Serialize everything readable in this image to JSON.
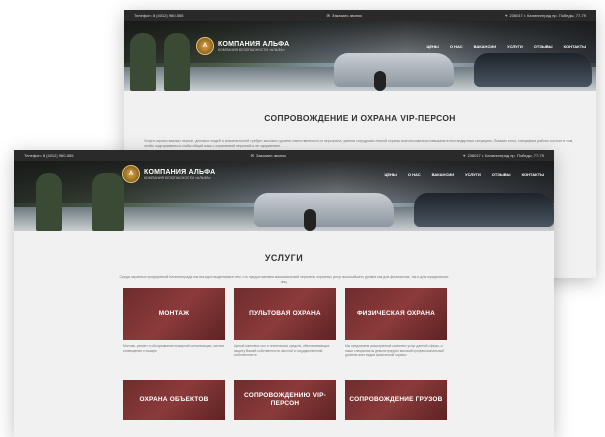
{
  "back_window": {
    "topbar": {
      "phone": "Телефон: 8 (4012) 960-555",
      "callback": "Заказать звонок",
      "address": "236017 г. Калининград пр. Победы, 77-79"
    },
    "brand": {
      "emblem": "A",
      "title": "КОМПАНИЯ АЛЬФА",
      "subtitle": "КОМПАНИЯ БЕЗОПАСНОСТИ «АЛЬФА»"
    },
    "nav": [
      "ЦЕНЫ",
      "О НАС",
      "ВАКАНСИИ",
      "УСЛУГИ",
      "ОТЗЫВЫ",
      "КОНТАКТЫ"
    ],
    "heading": "СОПРОВОЖДЕНИЕ И ОХРАНА VIP-ПЕРСОН",
    "paragraph": "Услуга охраны важных персон, деловых людей и знаменитостей требует высокого уровня ответственности от персонала, умения сотрудника личной охраны воспользоваться навыками в нестандартных ситуациях. Помимо этого, специфика работы состоит в том, чтобы подстраиваться чтобы общий язык с охраняемой персоной и ее окружением."
  },
  "front_window": {
    "topbar": {
      "phone": "Телефон: 8 (4012) 960-555",
      "callback": "Заказать звонок",
      "address": "236017 г. Калининград пр. Победы, 77-79"
    },
    "brand": {
      "emblem": "A",
      "title": "КОМПАНИЯ АЛЬФА",
      "subtitle": "КОМПАНИЯ БЕЗОПАСНОСТИ «АЛЬФА»"
    },
    "nav": [
      "ЦЕНЫ",
      "О НАС",
      "ВАКАНСИИ",
      "УСЛУГИ",
      "ОТЗЫВЫ",
      "КОНТАКТЫ"
    ],
    "heading": "УСЛУГИ",
    "intro": "Среди охранных предприятий Калининграда мы выгодно выделяемся тем, что предоставляем максимальный перечень охранных услуг высочайшего уровня как для физических, так и для юридических лиц.",
    "services": [
      {
        "title": "МОНТАЖ",
        "desc": "Монтаж, ремонт и обслуживание пожарной сигнализации, систем оповещения о пожаре"
      },
      {
        "title": "ПУЛЬТОВАЯ ОХРАНА",
        "desc": "Целый комплекс сил и технических средств, обеспечивающих защиту Вашей собственности частной и государственной собственности"
      },
      {
        "title": "ФИЗИЧЕСКАЯ ОХРАНА",
        "desc": "Мы предлагаем расширенный комплекс услуг данной сферы, и наши специалисты демонстрируют высокий профессиональный уровень всех видов физической охраны"
      },
      {
        "title": "ОХРАНА ОБЪЕКТОВ",
        "desc": ""
      },
      {
        "title": "СОПРОВОЖДЕНИЮ VIP-ПЕРСОН",
        "desc": ""
      },
      {
        "title": "СОПРОВОЖДЕНИЕ ГРУЗОВ",
        "desc": ""
      }
    ]
  }
}
